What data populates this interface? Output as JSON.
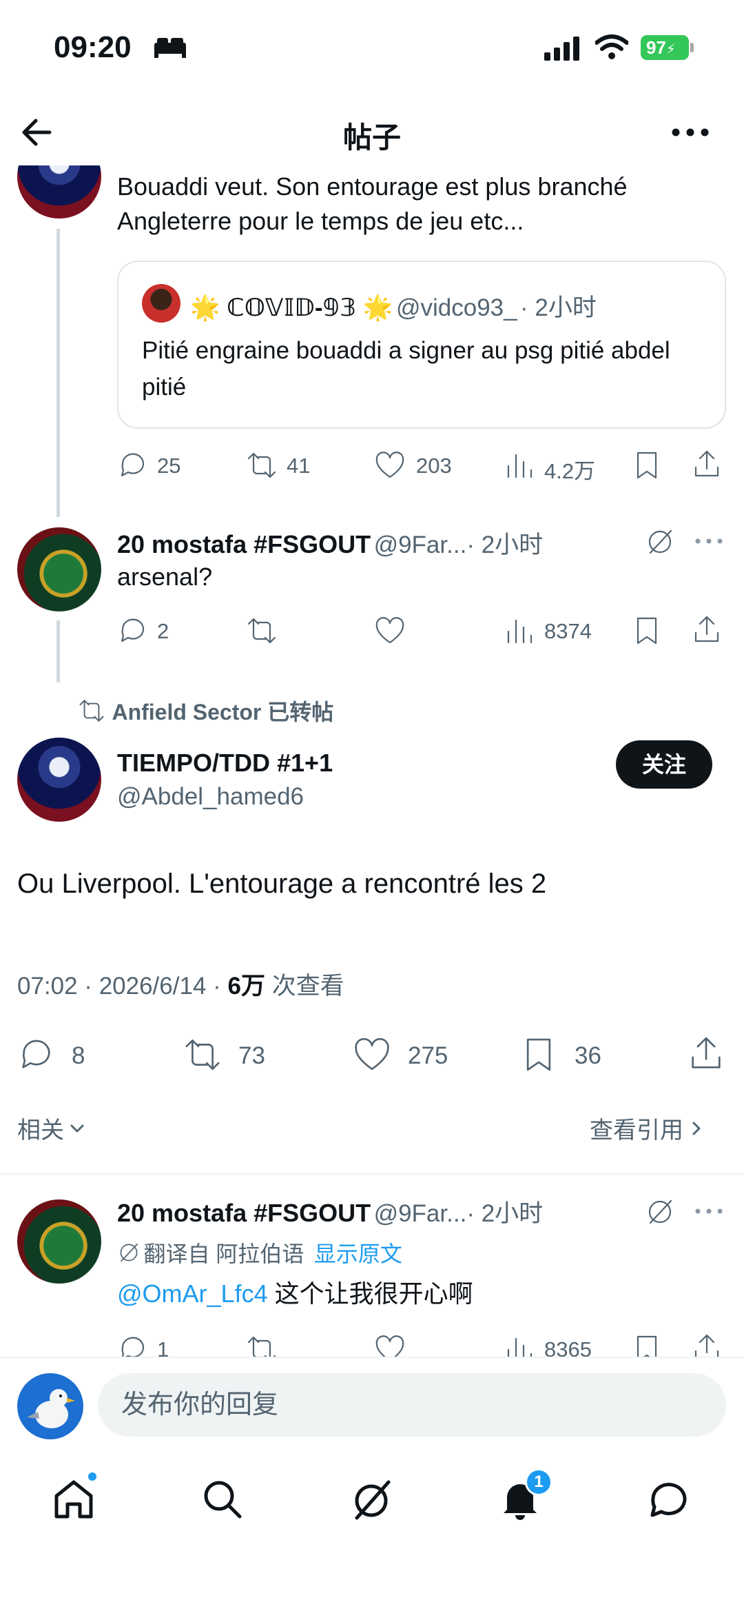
{
  "status_bar": {
    "time": "09:20",
    "battery": "97"
  },
  "header": {
    "title": "帖子"
  },
  "tweet_top": {
    "text": "Bouaddi veut. Son entourage est plus branché Angleterre pour le temps de jeu etc...",
    "quote": {
      "name": "🌟 ℂ𝕆𝕍𝕀𝔻-𝟡𝟛 🌟",
      "handle": "@vidco93_",
      "time": "· 2小时",
      "text": "Pitié engraine bouaddi a signer au psg pitié abdel pitié"
    },
    "actions": {
      "replies": "25",
      "retweets": "41",
      "likes": "203",
      "views": "4.2万"
    }
  },
  "reply_arsenal": {
    "name": "20 mostafa #FSGOUT",
    "handle": "@9Far...",
    "time": "· 2小时",
    "text": "arsenal?",
    "actions": {
      "replies": "2",
      "retweets": "",
      "likes": "",
      "views": "8374"
    }
  },
  "main_tweet": {
    "retweeted_by": "Anfield Sector 已转帖",
    "name": "TIEMPO/TDD #1+1",
    "handle": "@Abdel_hamed6",
    "follow_label": "关注",
    "text": "Ou Liverpool. L'entourage a rencontré les 2",
    "meta_time": "07:02 · 2026/6/14 · ",
    "meta_views": "6万",
    "meta_views_suffix": " 次查看",
    "actions": {
      "replies": "8",
      "retweets": "73",
      "likes": "275",
      "bookmarks": "36"
    }
  },
  "related_bar": {
    "left": "相关",
    "right": "查看引用"
  },
  "reply_bottom": {
    "name": "20 mostafa #FSGOUT",
    "handle": "@9Far...",
    "time": "· 2小时",
    "translated_label": "翻译自 阿拉伯语",
    "show_original": "显示原文",
    "mention": "@OmAr_Lfc4",
    "text": " 这个让我很开心啊",
    "actions": {
      "replies": "1",
      "views": "8365"
    }
  },
  "composer": {
    "placeholder": "发布你的回复"
  },
  "bottom_nav": {
    "notification_badge": "1"
  }
}
